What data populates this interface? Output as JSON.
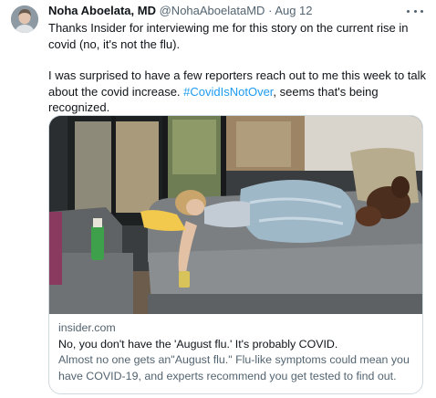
{
  "tweet": {
    "author_name": "Noha Aboelata, MD",
    "author_handle": "@NohaAboelataMD",
    "separator": "·",
    "date": "Aug 12",
    "text_line1": "Thanks Insider for interviewing me for this story on the current rise in covid (no, it's not the flu).",
    "text_line2_before": "I was surprised to have a few reporters reach out to me this week to talk about the covid increase. ",
    "hashtag": "#CovidIsNotOver",
    "text_line2_after": ", seems that's being recognized."
  },
  "card": {
    "domain": "insider.com",
    "title": "No, you don't have the 'August flu.' It's probably COVID.",
    "description": "Almost no one gets an\"August flu.\" Flu-like symptoms could mean you have COVID-19, and experts recommend you get tested to find out.",
    "image_subject": "person-lying-on-couch-with-dog"
  },
  "icons": {
    "more": "more-options-icon",
    "avatar": "profile-avatar"
  },
  "colors": {
    "link": "#1d9bf0",
    "secondary_text": "#536471",
    "primary_text": "#0f1419",
    "border": "#cfd9de"
  }
}
